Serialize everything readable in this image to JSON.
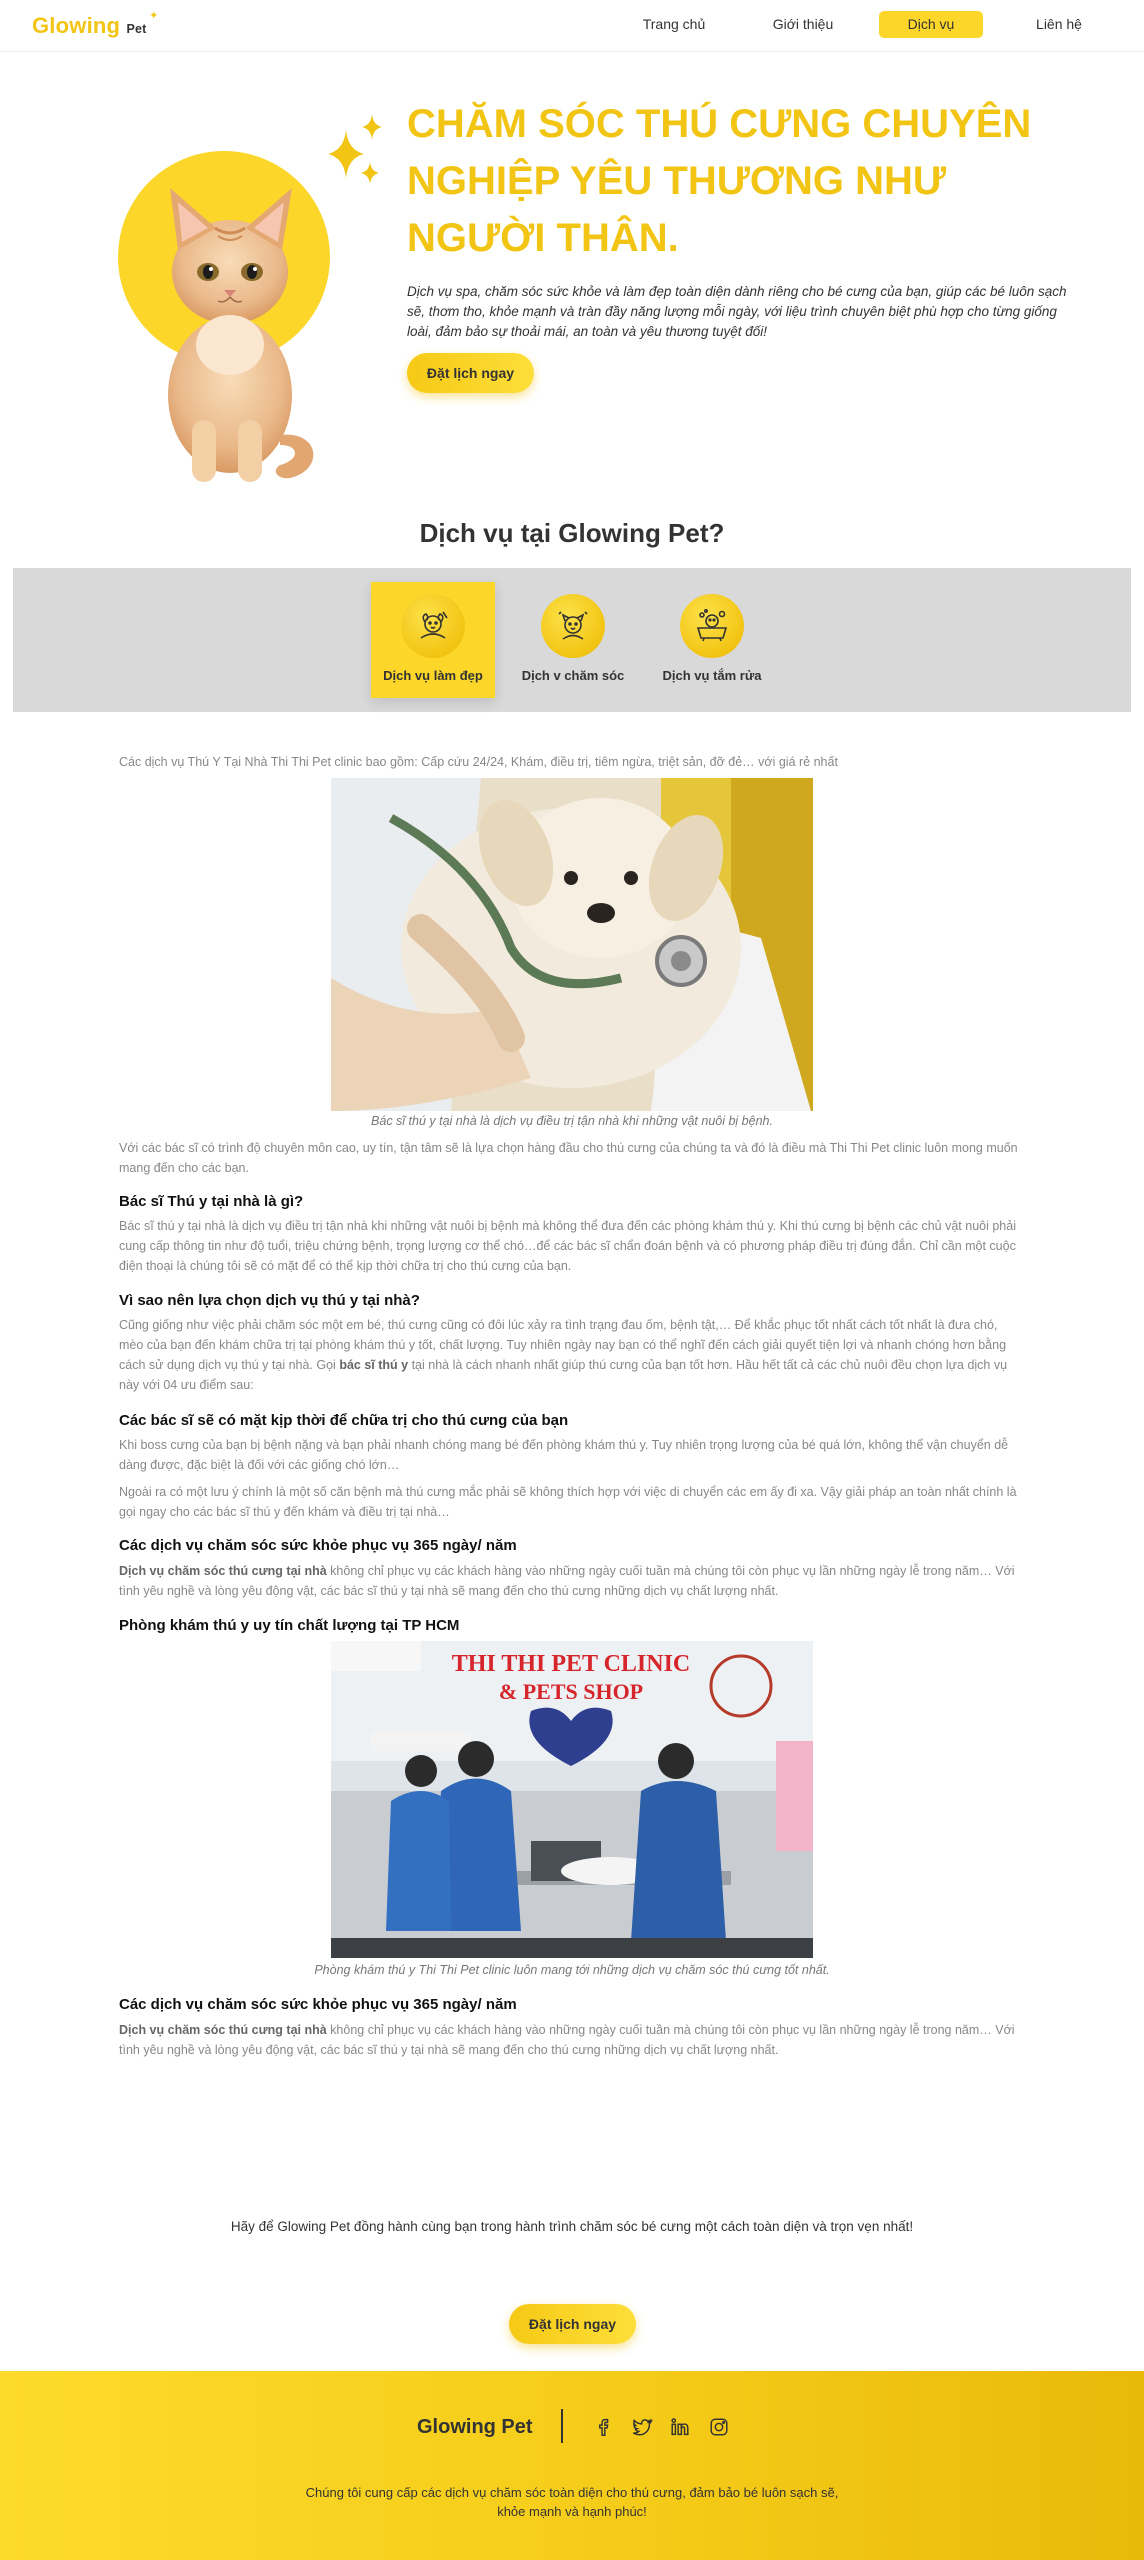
{
  "nav": {
    "logo_main": "Glowing",
    "logo_accent": "Pet",
    "items": [
      {
        "label": "Trang chủ"
      },
      {
        "label": "Giới thiệu"
      },
      {
        "label": "Dịch vụ"
      },
      {
        "label": "Liên hệ"
      }
    ],
    "active_item": "Dịch vụ"
  },
  "hero": {
    "title": "CHĂM SÓC THÚ CƯNG CHUYÊN NGHIỆP YÊU THƯƠNG NHƯ NGƯỜI THÂN.",
    "description": "Dịch vụ spa, chăm sóc sức khỏe và làm đẹp toàn diện dành riêng cho bé cưng của bạn, giúp các bé luôn sạch sẽ, thơm tho, khỏe mạnh và tràn đầy năng lượng mỗi ngày, với liệu trình chuyên biệt phù hợp cho từng giống loài, đảm bảo sự thoải mái, an toàn và yêu thương tuyệt đối!",
    "cta": "Đặt lịch ngay"
  },
  "services": {
    "title": "Dịch vụ tại Glowing Pet?",
    "cards": [
      {
        "label": "Dịch vụ làm đẹp",
        "icon": "grooming-icon"
      },
      {
        "label": "Dịch v chăm sóc",
        "icon": "pet-care-icon"
      },
      {
        "label": "Dịch vụ tắm rửa",
        "icon": "bath-icon"
      }
    ],
    "active_card": "Dịch vụ làm đẹp"
  },
  "article": {
    "intro": "Các dịch vụ Thú Y Tại Nhà Thi Thi Pet clinic bao gồm: Cấp cứu 24/24, Khám, điều trị, tiêm ngừa, triệt sản, đỡ đẻ… với giá rẻ nhất",
    "caption1": "Bác sĩ thú y tại nhà là dịch vụ điều trị tận nhà khi những vật nuôi bị bệnh.",
    "p_after_img1": "Với các bác sĩ có trình độ chuyên môn cao, uy tín, tận tâm sẽ là lựa chọn hàng đầu cho thú cưng của chúng ta và đó là điều mà Thi Thi Pet clinic luôn mong muốn mang đến cho các bạn.",
    "h1": "Bác sĩ Thú y tại nhà là gì?",
    "p1": "Bác sĩ thú y tại nhà là dịch vụ điều trị tận nhà khi những vật nuôi bị bệnh mà không thể đưa đến các phòng khám thú y. Khi thú cưng bị bệnh các chủ vật nuôi phải cung cấp thông tin như độ tuổi, triệu chứng bệnh, trọng lượng cơ thể chó…để các bác sĩ chẩn đoán bệnh và có phương pháp điều trị đúng đắn. Chỉ cần một cuộc điện thoại là chúng tôi sẽ có mặt để có thể kịp thời chữa trị cho thú cưng của bạn.",
    "h2": "Vì sao nên lựa chọn dịch vụ thú y tại nhà?",
    "p2_a": "Cũng giống như việc phải chăm sóc một em bé, thú cưng cũng có đôi lúc xảy ra tình trạng đau ốm, bệnh tật,… Để khắc phục tốt nhất cách tốt nhất là đưa chó, mèo của bạn đến khám chữa trị tại phòng khám thú y tốt, chất lượng. Tuy nhiên ngày nay bạn có thể nghĩ đến cách giải quyết tiện lợi và nhanh chóng hơn bằng cách sử dụng dịch vụ thú y tại nhà. Gọi ",
    "p2_bold": "bác sĩ thú y",
    "p2_b": " tại nhà là cách nhanh nhất giúp thú cưng của bạn tốt hơn. Hầu hết tất cả các chủ nuôi đều chọn lựa dịch vụ này với 04 ưu điểm sau:",
    "h3": "Các bác sĩ sẽ có mặt kịp thời để chữa trị cho thú cưng của bạn",
    "p3": "Khi boss cưng của bạn bị bệnh nặng và bạn phải nhanh chóng mang bé đến phòng khám thú y. Tuy nhiên trọng lượng của bé quá lớn, không thể vận chuyển dễ dàng được, đặc biệt là đối với các giống chó lớn…",
    "p4": "Ngoài ra có một lưu ý chính là một số căn bệnh mà thú cưng mắc phải sẽ không thích hợp với việc di chuyển các em ấy đi xa. Vậy giải pháp an toàn nhất chính là gọi ngay cho các bác sĩ thú y đến khám và điều trị tại nhà…",
    "h4": "Các dịch vụ chăm sóc sức khỏe phục vụ 365 ngày/ năm",
    "p5_bold": "Dịch vụ chăm sóc thú cưng tại nhà",
    "p5": " không chỉ phục vụ các khách hàng vào những ngày cuối tuần mà chúng tôi còn phục vụ lần những ngày lễ trong năm… Với tình yêu nghề và lòng yêu động vật, các bác sĩ thú y tại nhà sẽ mang đến cho thú cưng những dịch vụ chất lượng nhất.",
    "h5": "Phòng khám thú y uy tín chất lượng tại TP HCM",
    "clinic_sign_line1": "THI THI PET CLINIC",
    "clinic_sign_line2": "& PETS SHOP",
    "caption2": "Phòng khám thú y Thi Thi Pet clinic luôn mang tới những dịch vụ chăm sóc thú cưng tốt nhất.",
    "h6": "Các dịch vụ chăm sóc sức khỏe phục vụ 365 ngày/ năm",
    "p6_bold": "Dịch vụ chăm sóc thú cưng tại nhà",
    "p6": " không chỉ phục vụ các khách hàng vào những ngày cuối tuần mà chúng tôi còn phục vụ lần những ngày lễ trong năm… Với tình yêu nghề và lòng yêu động vật, các bác sĩ thú y tại nhà sẽ mang đến cho thú cưng những dịch vụ chất lượng nhất."
  },
  "outro": {
    "text": "Hãy để Glowing Pet đồng hành cùng bạn trong hành trình chăm sóc bé cưng một cách toàn diện và trọn vẹn nhất!",
    "cta": "Đặt lịch ngay"
  },
  "footer": {
    "brand": "Glowing Pet",
    "socials": [
      "facebook-icon",
      "twitter-icon",
      "linkedin-icon",
      "instagram-icon"
    ],
    "text_line1": "Chúng tôi cung cấp các dịch vụ chăm sóc toàn diện cho thú cưng, đảm bảo bé luôn sạch sẽ,",
    "text_line2": "khỏe mạnh và hạnh phúc!"
  },
  "colors": {
    "accent": "#f2c413",
    "nav_active": "#fcd72a",
    "band": "#d9d9d9"
  }
}
